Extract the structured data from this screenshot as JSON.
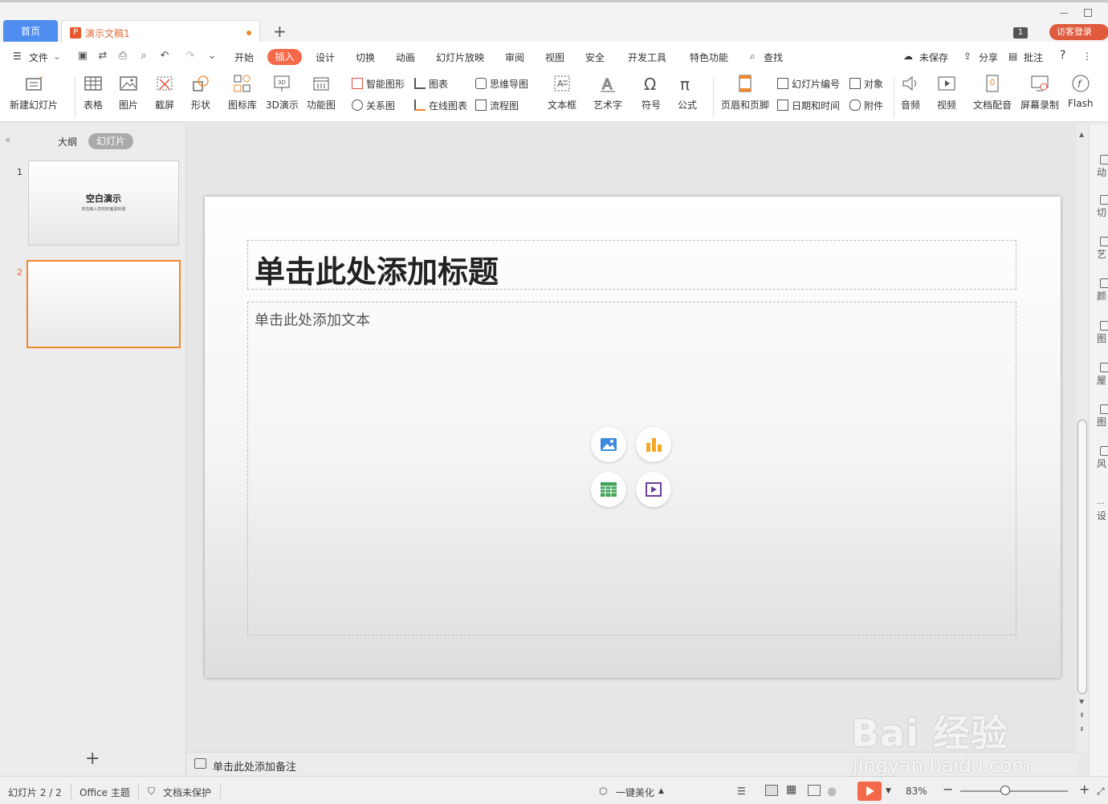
{
  "tabs": {
    "home": "首页",
    "document": "演示文稿1",
    "new_tab": "+",
    "window_count": "1",
    "guest_login": "访客登录"
  },
  "menu": {
    "file": "文件",
    "items": [
      "开始",
      "插入",
      "设计",
      "切换",
      "动画",
      "幻灯片放映",
      "审阅",
      "视图",
      "安全",
      "开发工具",
      "特色功能"
    ],
    "active": "插入",
    "search": "查找",
    "unsaved": "未保存",
    "share": "分享",
    "comment": "批注",
    "help": "?"
  },
  "ribbon": {
    "new_slide": "新建幻灯片",
    "table": "表格",
    "picture": "图片",
    "screenshot": "截屏",
    "shape": "形状",
    "icon_library": "图标库",
    "demo_3d": "3D演示",
    "function_chart": "功能图",
    "smart_art": "智能图形",
    "chart": "图表",
    "relation_chart": "关系图",
    "online_chart": "在线图表",
    "mind_map": "思维导图",
    "flow_chart": "流程图",
    "text_box": "文本框",
    "word_art": "艺术字",
    "symbol": "符号",
    "formula": "公式",
    "header_footer": "页眉和页脚",
    "slide_number": "幻灯片编号",
    "object": "对象",
    "date_time": "日期和时间",
    "attachment": "附件",
    "audio": "音频",
    "video": "视频",
    "doc_voice": "文档配音",
    "screen_record": "屏幕录制",
    "flash": "Flash"
  },
  "left_panel": {
    "outline_tab": "大纲",
    "slides_tab": "幻灯片",
    "thumbs": [
      {
        "num": "1",
        "title": "空白演示",
        "subtitle": "单击输入您的封面副标题"
      },
      {
        "num": "2"
      }
    ]
  },
  "slide": {
    "title_placeholder": "单击此处添加标题",
    "body_placeholder": "单击此处添加文本"
  },
  "notes": {
    "placeholder": "单击此处添加备注"
  },
  "right_panel": {
    "items": [
      "动",
      "切",
      "艺",
      "颜",
      "图",
      "屋",
      "图",
      "风",
      "设"
    ]
  },
  "status": {
    "slide_counter": "幻灯片 2 / 2",
    "theme": "Office 主题",
    "protection": "文档未保护",
    "beautify": "一键美化",
    "zoom": "83%"
  },
  "watermark": {
    "brand": "Bai 经验",
    "url": "jingyan.baidu.com"
  },
  "colors": {
    "accent": "#f4694a",
    "home_tab": "#4f8ef0",
    "selected_thumb": "#f0882c"
  }
}
